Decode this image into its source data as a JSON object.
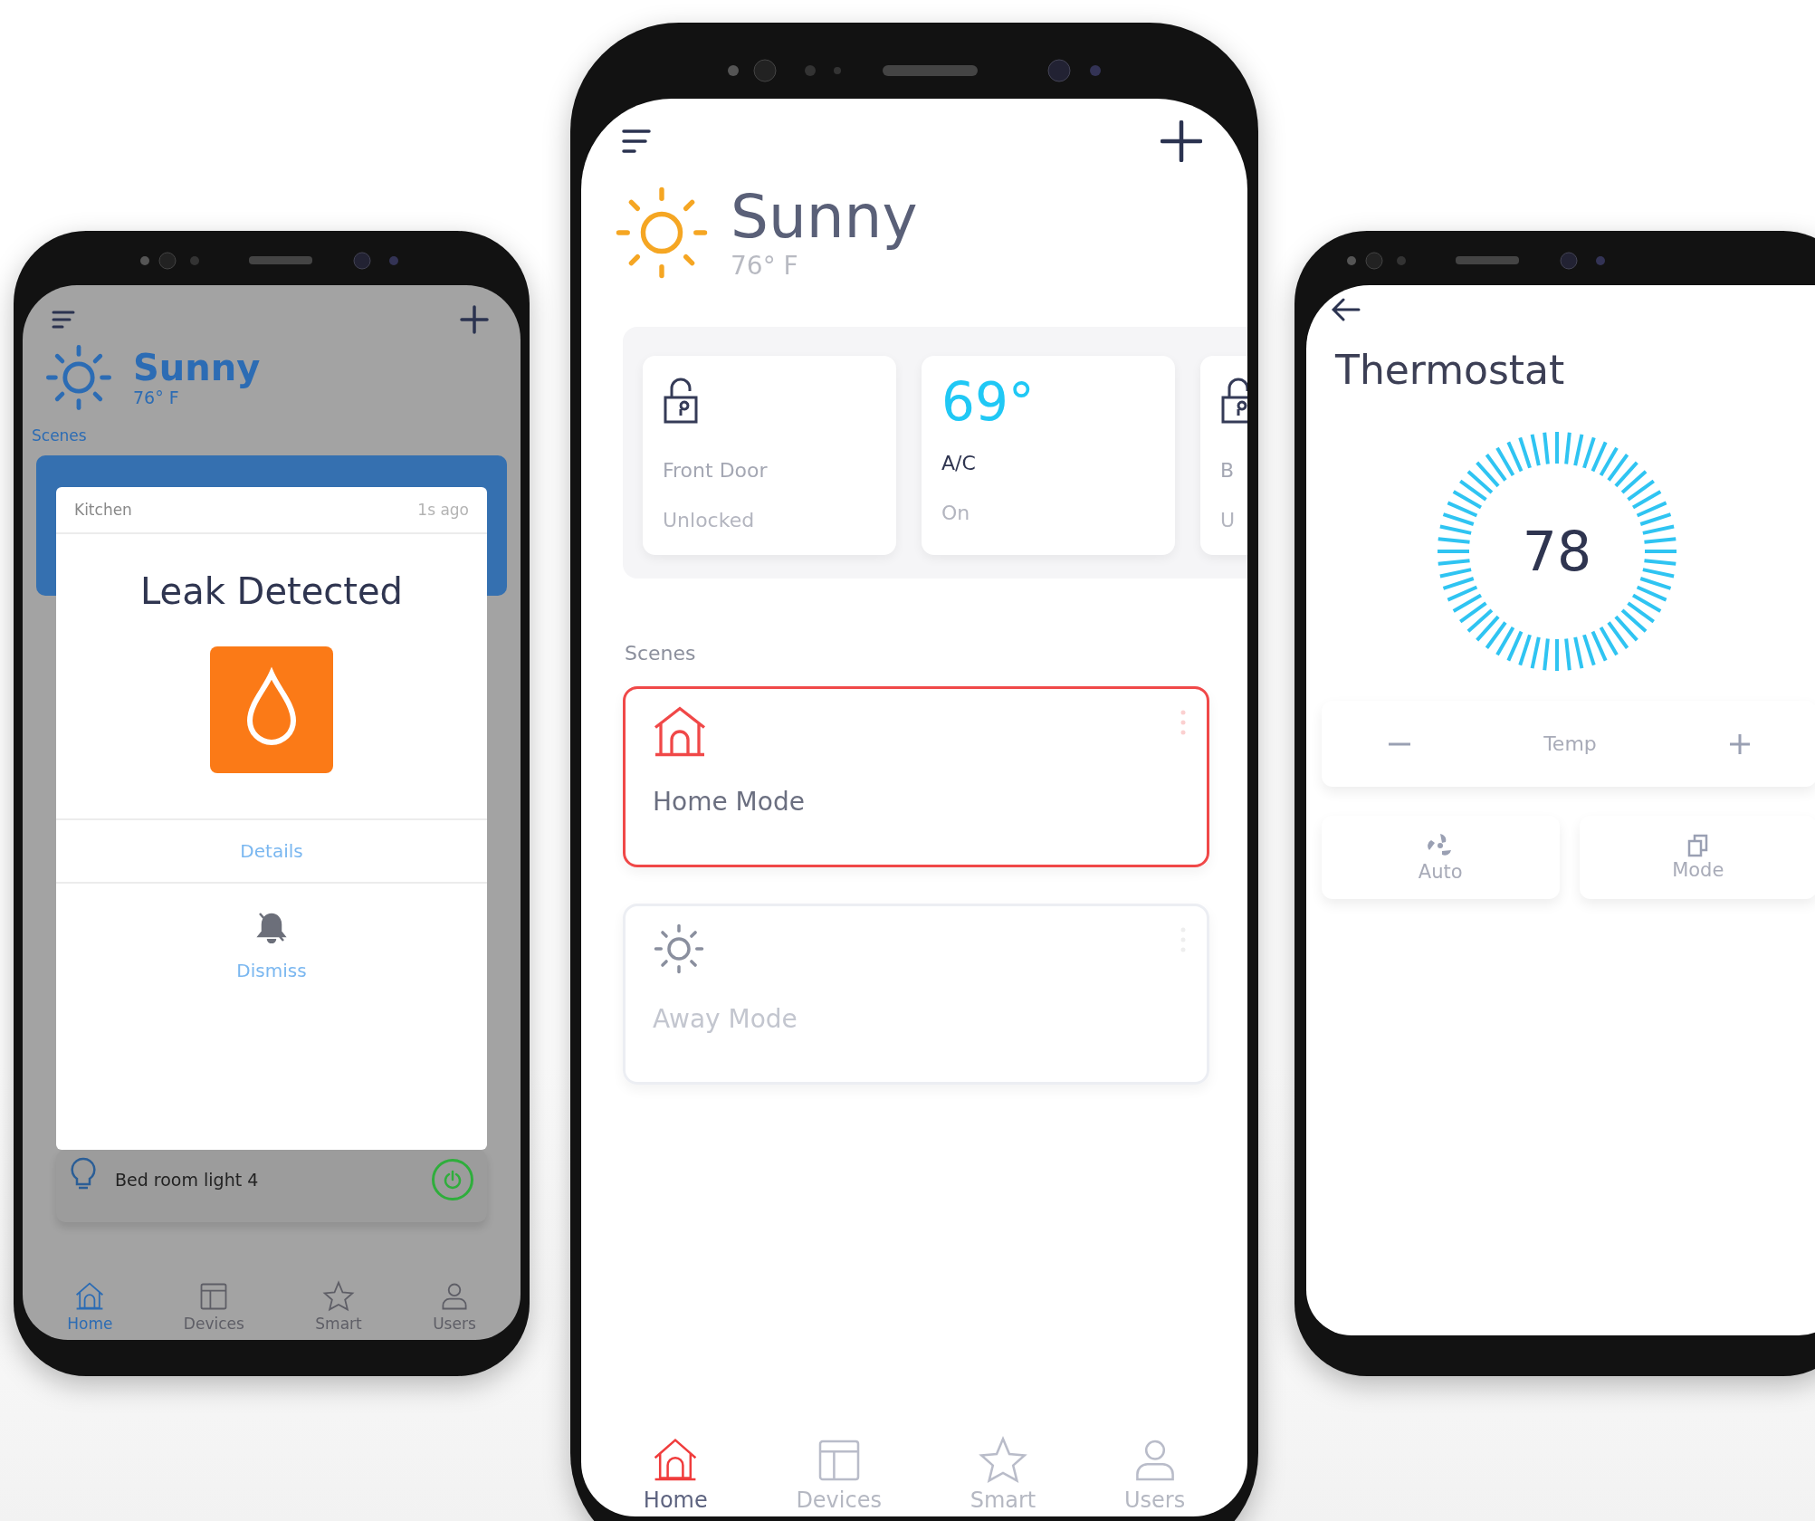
{
  "left_phone": {
    "weather": {
      "condition": "Sunny",
      "temperature": "76° F"
    },
    "scenes_label": "Scenes",
    "light": {
      "name": "Bed room light 4",
      "on": true
    },
    "alert": {
      "location": "Kitchen",
      "time": "1s ago",
      "title": "Leak Detected",
      "actions": [
        {
          "kind": "link",
          "label": "Details"
        },
        {
          "kind": "mute",
          "label": "Dismiss"
        }
      ]
    },
    "nav": [
      {
        "kind": "home",
        "label": "Home",
        "selected": true
      },
      {
        "kind": "devices",
        "label": "Devices",
        "selected": false
      },
      {
        "kind": "smart",
        "label": "Smart",
        "selected": false
      },
      {
        "kind": "users",
        "label": "Users",
        "selected": false
      }
    ]
  },
  "center_phone": {
    "weather": {
      "condition": "Sunny",
      "temperature": "76° F"
    },
    "devices": [
      {
        "kind": "lock",
        "name": "Front Door",
        "status": "Unlocked"
      },
      {
        "kind": "climate",
        "reading": "69°",
        "name": "A/C",
        "status": "On"
      },
      {
        "kind": "lock",
        "name": "B",
        "status": "U"
      }
    ],
    "scenes_label": "Scenes",
    "scenes": [
      {
        "kind": "home",
        "name": "Home Mode",
        "selected": true
      },
      {
        "kind": "away",
        "name": "Away Mode",
        "selected": false
      }
    ],
    "nav": [
      {
        "kind": "home",
        "label": "Home",
        "selected": true
      },
      {
        "kind": "devices",
        "label": "Devices",
        "selected": false
      },
      {
        "kind": "smart",
        "label": "Smart",
        "selected": false
      },
      {
        "kind": "users",
        "label": "Users",
        "selected": false
      }
    ]
  },
  "right_phone": {
    "title": "Thermostat",
    "setpoint": "78",
    "control_label": "Temp",
    "modes": [
      {
        "kind": "fan",
        "label": "Auto"
      },
      {
        "kind": "copy",
        "label": "Mode"
      }
    ]
  }
}
